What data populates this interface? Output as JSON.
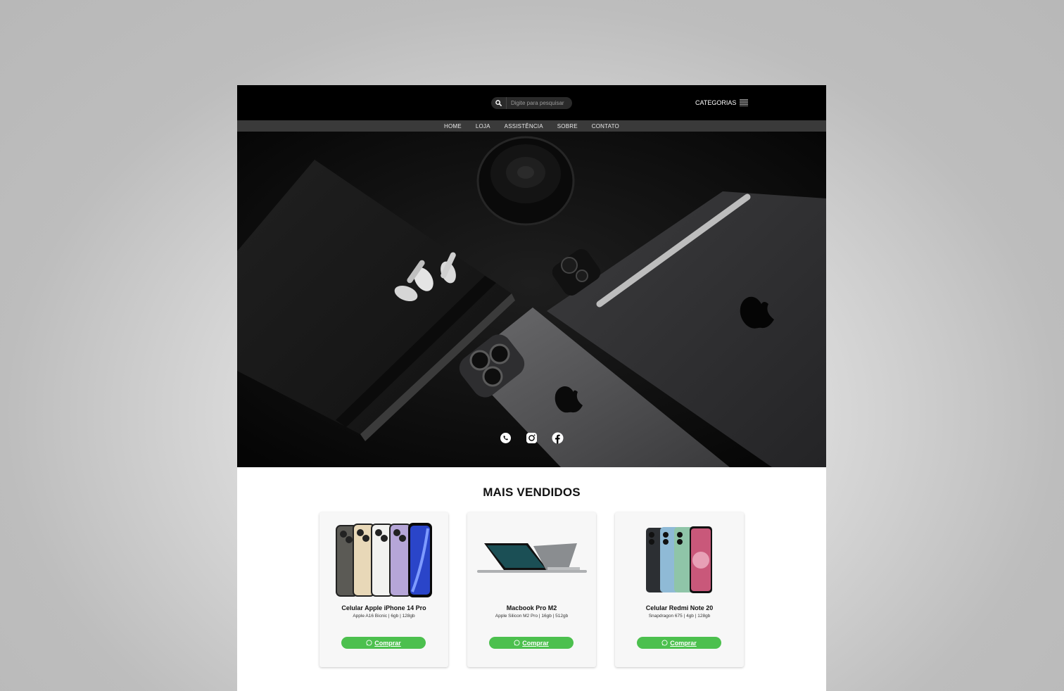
{
  "header": {
    "search_placeholder": "Digite para pesquisar",
    "categories_label": "CATEGORIAS"
  },
  "nav": {
    "items": [
      {
        "label": "HOME"
      },
      {
        "label": "LOJA"
      },
      {
        "label": "ASSISTÊNCIA"
      },
      {
        "label": "SOBRE"
      },
      {
        "label": "CONTATO"
      }
    ]
  },
  "hero": {
    "socials": [
      "whatsapp-icon",
      "instagram-icon",
      "facebook-icon"
    ]
  },
  "products": {
    "title": "MAIS VENDIDOS",
    "items": [
      {
        "name": "Celular Apple iPhone 14 Pro",
        "spec": "Apple A16 Bicnic | 6gb | 128gb",
        "buy": "Comprar"
      },
      {
        "name": "Macbook Pro M2",
        "spec": "Apple Silicon M2 Pro | 16gb | 512gb",
        "buy": "Comprar"
      },
      {
        "name": "Celular Redmi Note 20",
        "spec": "Snapdragon 675 | 4gb | 128gb",
        "buy": "Comprar"
      }
    ]
  },
  "colors": {
    "header_bg": "#000000",
    "nav_bg": "#3a3a3a",
    "buy_button": "#4cc04e"
  }
}
